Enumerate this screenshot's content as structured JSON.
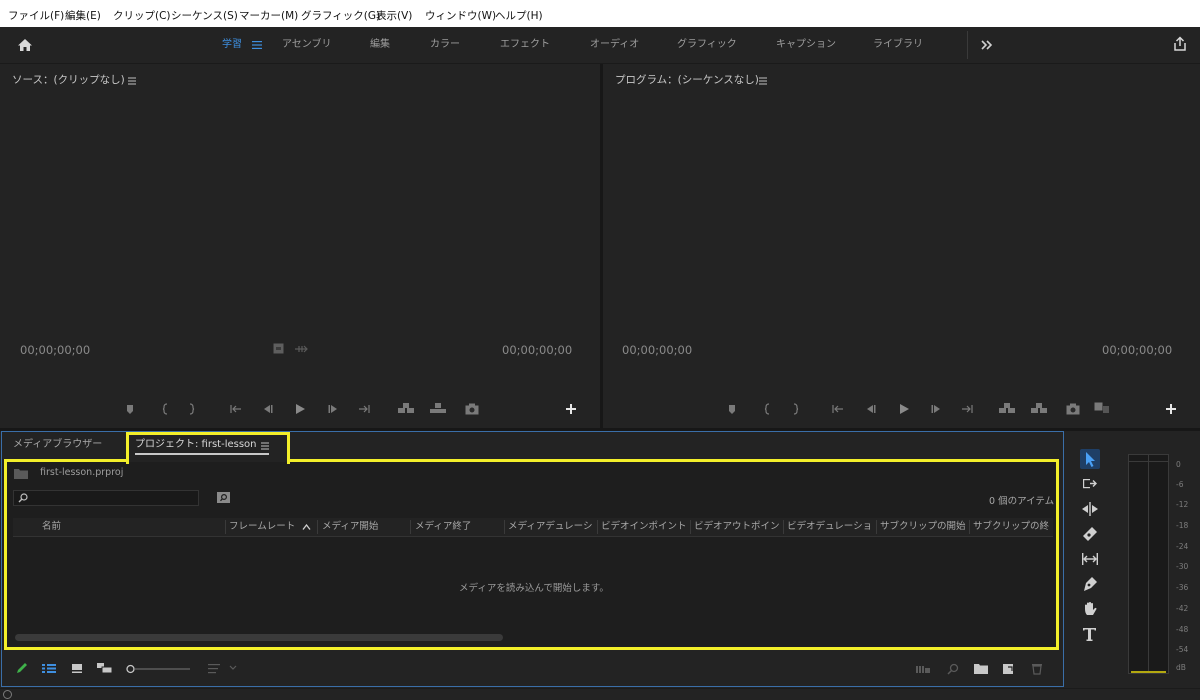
{
  "menu": [
    "ファイル(F)",
    "編集(E)",
    "クリップ(C)",
    "シーケンス(S)",
    "マーカー(M)",
    "グラフィック(G)",
    "表示(V)",
    "ウィンドウ(W)",
    "ヘルプ(H)"
  ],
  "workspaces": [
    "学習",
    "アセンブリ",
    "編集",
    "カラー",
    "エフェクト",
    "オーディオ",
    "グラフィック",
    "キャプション",
    "ライブラリ"
  ],
  "active_workspace": "学習",
  "source_monitor": {
    "title": "ソース：(クリップなし)",
    "timecode_in": "00;00;00;00",
    "timecode_out": "00;00;00;00"
  },
  "program_monitor": {
    "title": "プログラム：(シーケンスなし)",
    "timecode_in": "00;00;00;00",
    "timecode_out": "00;00;00;00"
  },
  "project_panel": {
    "tabs": [
      "メディアブラウザー",
      "プロジェクト: first-lesson"
    ],
    "active_tab": "プロジェクト: first-lesson",
    "file_name": "first-lesson.prproj",
    "search_placeholder": "",
    "item_count": "0 個のアイテム",
    "columns": [
      "名前",
      "フレームレート",
      "メディア開始",
      "メディア終了",
      "メディアデュレーシ",
      "ビデオインポイント",
      "ビデオアウトポイン",
      "ビデオデュレーショ",
      "サブクリップの開始",
      "サブクリップの終"
    ],
    "empty_message": "メディアを読み込んで開始します。"
  },
  "audio_meter": {
    "scale": [
      "0",
      "-6",
      "-12",
      "-18",
      "-24",
      "-30",
      "-36",
      "-42",
      "-48",
      "-54",
      "dB"
    ]
  },
  "colors": {
    "accent": "#3e8fe0",
    "highlight": "#f3ef2a",
    "panel_border": "#3a6ea8",
    "background": "#232323"
  },
  "icons": [
    "home-icon",
    "hamburger-menu-icon",
    "overflow-chevron-icon",
    "share-export-icon",
    "add-marker-icon",
    "mark-in-icon",
    "mark-out-icon",
    "go-to-in-icon",
    "step-back-icon",
    "play-icon",
    "step-forward-icon",
    "go-to-out-icon",
    "insert-icon",
    "overwrite-icon",
    "export-frame-icon",
    "plus-icon",
    "folder-icon",
    "search-icon",
    "new-bin-from-search-icon",
    "sort-ascending-icon",
    "pencil-icon",
    "list-view-icon",
    "icon-view-icon",
    "freeform-view-icon",
    "zoom-slider-icon",
    "sort-icons-icon",
    "automate-to-sequence-icon",
    "find-icon",
    "new-bin-icon",
    "new-item-icon",
    "clear-icon",
    "selection-tool-icon",
    "track-select-forward-tool-icon",
    "ripple-edit-tool-icon",
    "razor-tool-icon",
    "slip-tool-icon",
    "pen-tool-icon",
    "hand-tool-icon",
    "type-tool-icon"
  ]
}
